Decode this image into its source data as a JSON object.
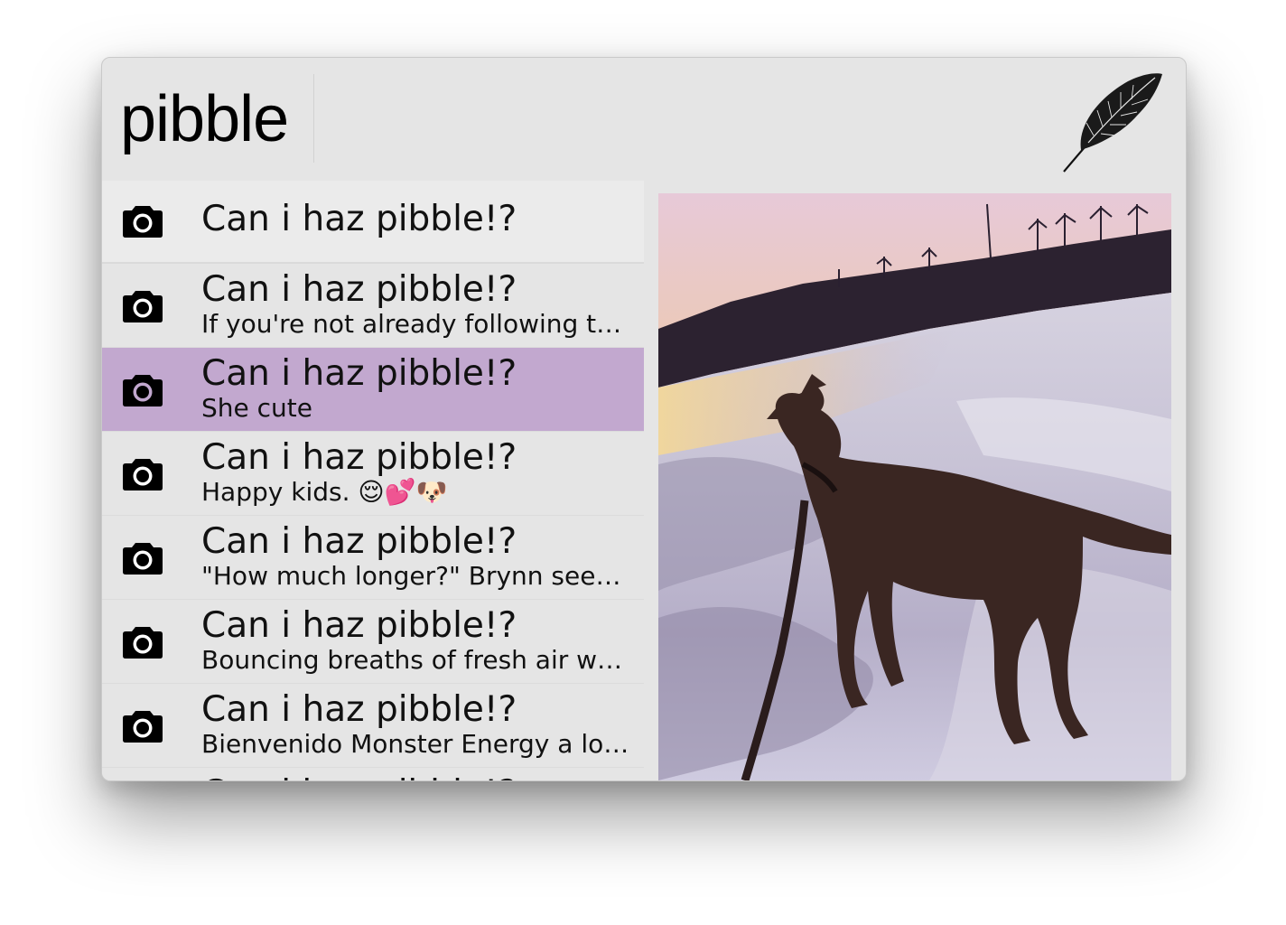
{
  "search": {
    "query": "pibble"
  },
  "app": {
    "logo_icon": "feather-icon",
    "selection_color": "#c2a8cf"
  },
  "results": [
    {
      "title": "Can i haz pibble!?",
      "subtitle": "",
      "icon": "camera-icon"
    },
    {
      "title": "Can i haz pibble!?",
      "subtitle": "If you're not already following t…",
      "icon": "camera-icon"
    },
    {
      "title": "Can i haz pibble!?",
      "subtitle": "She cute",
      "icon": "camera-icon"
    },
    {
      "title": "Can i haz pibble!?",
      "subtitle": "Happy kids. 😌💕🐶",
      "icon": "camera-icon"
    },
    {
      "title": "Can i haz pibble!?",
      "subtitle": "\"How much longer?\" Brynn see…",
      "icon": "camera-icon"
    },
    {
      "title": "Can i haz pibble!?",
      "subtitle": "Bouncing breaths of fresh air w…",
      "icon": "camera-icon"
    },
    {
      "title": "Can i haz pibble!?",
      "subtitle": "Bienvenido Monster Energy a lo…",
      "icon": "camera-icon"
    },
    {
      "title": "Can i haz pibble!?",
      "subtitle": "",
      "icon": "camera-icon"
    }
  ],
  "selected_index": 2,
  "preview": {
    "subject": "dog-on-frozen-lake-photo"
  }
}
